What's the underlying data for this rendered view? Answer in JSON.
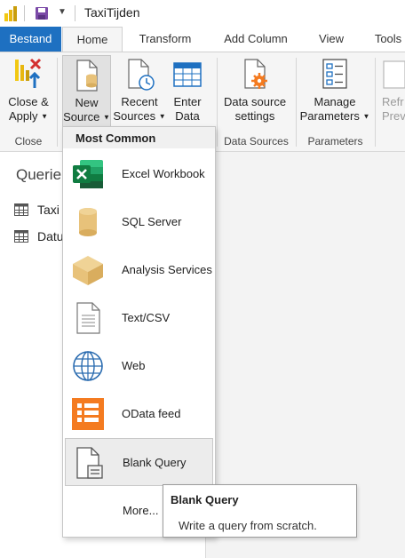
{
  "window": {
    "title": "TaxiTijden"
  },
  "tabs": [
    {
      "label": "Bestand"
    },
    {
      "label": "Home"
    },
    {
      "label": "Transform"
    },
    {
      "label": "Add Column"
    },
    {
      "label": "View"
    },
    {
      "label": "Tools"
    }
  ],
  "ribbon": {
    "close_apply": {
      "line1": "Close &",
      "line2": "Apply"
    },
    "new_source": {
      "line1": "New",
      "line2": "Source"
    },
    "recent_sources": {
      "line1": "Recent",
      "line2": "Sources"
    },
    "enter_data": {
      "line1": "Enter",
      "line2": "Data"
    },
    "data_source_settings": {
      "line1": "Data source",
      "line2": "settings"
    },
    "manage_parameters": {
      "line1": "Manage",
      "line2": "Parameters"
    },
    "refresh_preview": {
      "line1": "Refr",
      "line2": "Prev"
    },
    "groups": {
      "close": "Close",
      "data_sources": "Data Sources",
      "parameters": "Parameters"
    }
  },
  "queries_pane": {
    "title": "Querie",
    "items": [
      {
        "label": "Taxi"
      },
      {
        "label": "Datu"
      }
    ]
  },
  "new_source_menu": {
    "header": "Most Common",
    "items": [
      {
        "label": "Excel Workbook",
        "icon": "excel-icon"
      },
      {
        "label": "SQL Server",
        "icon": "database-icon"
      },
      {
        "label": "Analysis Services",
        "icon": "cube-icon"
      },
      {
        "label": "Text/CSV",
        "icon": "document-icon"
      },
      {
        "label": "Web",
        "icon": "globe-icon"
      },
      {
        "label": "OData feed",
        "icon": "odata-icon"
      },
      {
        "label": "Blank Query",
        "icon": "blank-query-icon"
      }
    ],
    "more": "More..."
  },
  "tooltip": {
    "title": "Blank Query",
    "body": "Write a query from scratch."
  },
  "colors": {
    "accent": "#1e70c1",
    "excel_green": "#217346",
    "gold": "#e8c27a",
    "odata_orange": "#f47b20"
  }
}
